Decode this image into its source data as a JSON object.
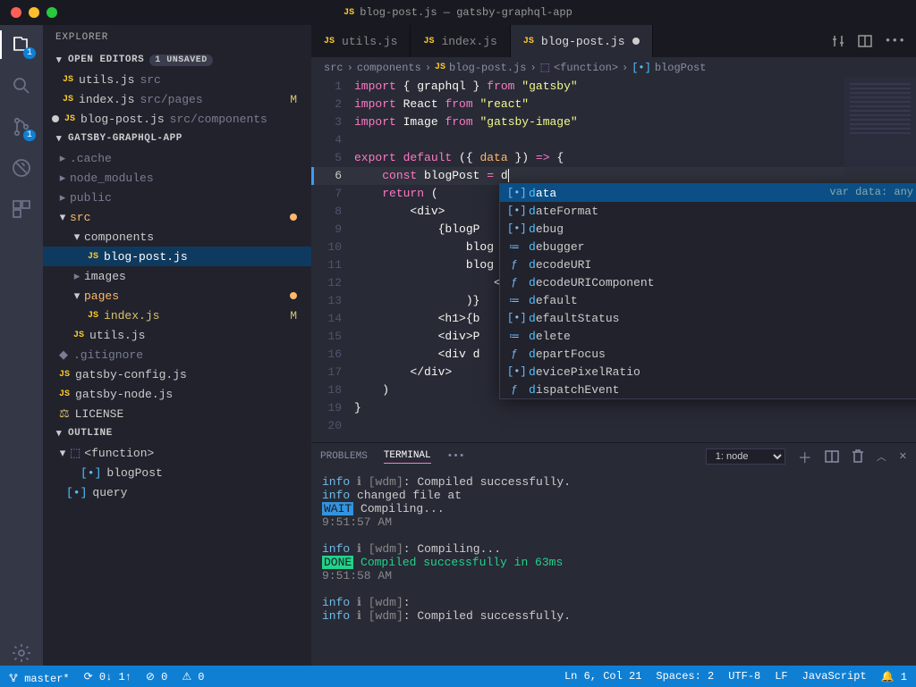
{
  "titlebar": {
    "title": "blog-post.js — gatsby-graphql-app"
  },
  "activity": {
    "explorer_badge": "1",
    "scm_badge": "1"
  },
  "sidebar": {
    "title": "EXPLORER",
    "open_editors_label": "OPEN EDITORS",
    "unsaved_label": "1 UNSAVED",
    "open_editors": [
      {
        "name": "utils.js",
        "path": "src",
        "status": ""
      },
      {
        "name": "index.js",
        "path": "src/pages",
        "status": "M"
      },
      {
        "name": "blog-post.js",
        "path": "src/components",
        "status": "●"
      }
    ],
    "project_label": "GATSBY-GRAPHQL-APP",
    "tree": {
      "cache": ".cache",
      "node_modules": "node_modules",
      "public": "public",
      "src": "src",
      "components": "components",
      "blog_post": "blog-post.js",
      "images": "images",
      "pages": "pages",
      "index": "index.js",
      "utils": "utils.js",
      "gitignore": ".gitignore",
      "gatsby_config": "gatsby-config.js",
      "gatsby_node": "gatsby-node.js",
      "license": "LICENSE"
    },
    "outline_label": "OUTLINE",
    "outline": {
      "fn": "<function>",
      "p1": "blogPost",
      "p2": "query"
    }
  },
  "tabs": {
    "t1": "utils.js",
    "t2": "index.js",
    "t3": "blog-post.js"
  },
  "breadcrumb": {
    "a": "src",
    "b": "components",
    "c": "blog-post.js",
    "d": "<function>",
    "e": "blogPost"
  },
  "code": {
    "l1": {
      "a": "import",
      "b": "{ ",
      "c": "graphql",
      "d": " }",
      "e": "from",
      "f": "\"gatsby\""
    },
    "l2": {
      "a": "import",
      "b": "React",
      "c": "from",
      "d": "\"react\""
    },
    "l3": {
      "a": "import",
      "b": "Image",
      "c": "from",
      "d": "\"gatsby-image\""
    },
    "l5": {
      "a": "export",
      "b": "default",
      "c": "({ ",
      "d": "data",
      "e": " })",
      "f": "=>",
      "g": "{"
    },
    "l6": {
      "a": "const",
      "b": "blogPost",
      "c": "=",
      "d": "d"
    },
    "l7": {
      "a": "return",
      "b": "("
    },
    "l8": "<div>",
    "l9": "{blogP",
    "l10": "blog",
    "l11": "blog",
    "l12": "<I",
    "l13": ")}",
    "l14": "<h1>{b",
    "l15": "<div>P",
    "l16": "<div d",
    "l17": "</div>",
    "l18": ")",
    "l19": "}"
  },
  "suggest": {
    "side": "var data: any",
    "items": [
      "data",
      "dateFormat",
      "debug",
      "debugger",
      "decodeURI",
      "decodeURIComponent",
      "default",
      "defaultStatus",
      "delete",
      "departFocus",
      "devicePixelRatio",
      "dispatchEvent"
    ]
  },
  "panel": {
    "problems": "PROBLEMS",
    "terminal": "TERMINAL",
    "more": "•••",
    "selector": "1: node",
    "lines": {
      "l1a": "info",
      "l1b": " ℹ [wdm]",
      "l1c": ": Compiled successfully.",
      "l2a": "info",
      "l2b": " changed file at",
      "l3a": "WAIT",
      "l3b": " Compiling...",
      "l4": "9:51:57 AM",
      "l6a": "info",
      "l6b": " ℹ [wdm]",
      "l6c": ": Compiling...",
      "l7a": "DONE",
      "l7b": " Compiled successfully in 63ms",
      "l8": "9:51:58 AM",
      "l10a": "info",
      "l10b": " ℹ [wdm]",
      "l10c": ":",
      "l11a": "info",
      "l11b": " ℹ [wdm]",
      "l11c": ": Compiled successfully."
    }
  },
  "status": {
    "branch": "master*",
    "sync": "⟳ 0↓ 1↑",
    "errors": "⊘ 0",
    "warns": "⚠ 0",
    "pos": "Ln 6, Col 21",
    "spaces": "Spaces: 2",
    "enc": "UTF-8",
    "eol": "LF",
    "lang": "JavaScript",
    "bell": "🔔 1"
  }
}
